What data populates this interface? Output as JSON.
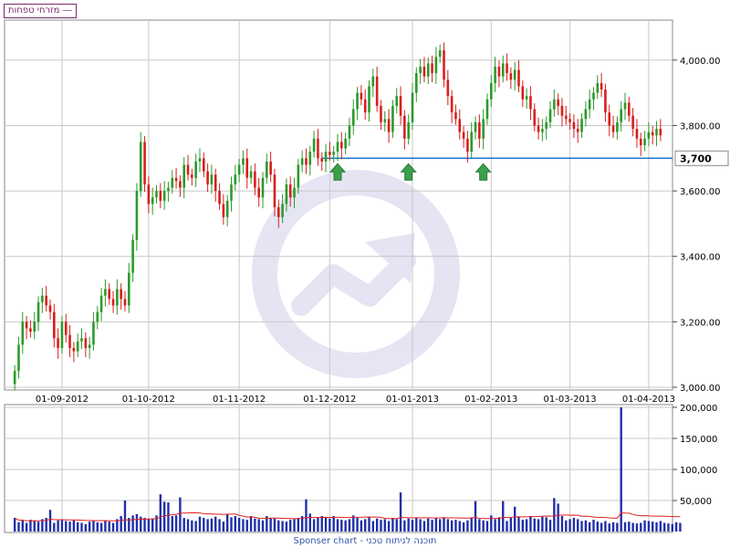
{
  "legend": {
    "label": "מזרחי טפחות ―"
  },
  "footer": {
    "text": "Sponser chart - תוכנה לניתוח טכני"
  },
  "colors": {
    "up": "#2a9a2a",
    "down": "#d81e1e",
    "volume": "#1f2fa8",
    "volume_ma": "#e02020",
    "support": "#1f78c8",
    "arrow": "#3aa04a",
    "grid": "#c8c8c8"
  },
  "chart_data": [
    {
      "type": "candlestick",
      "ylim": [
        3000,
        4100
      ],
      "y_ticks": [
        3000,
        3200,
        3400,
        3600,
        3800,
        4000
      ],
      "y_tick_labels": [
        "3,000.00",
        "3,200.00",
        "3,400.00",
        "3,600.00",
        "3,800.00",
        "4,000.00"
      ],
      "x_tick_labels": [
        "01-09-2012",
        "01-10-2012",
        "01-11-2012",
        "01-12-2012",
        "01-01-2013",
        "01-02-2013",
        "01-03-2013",
        "01-04-2013"
      ],
      "x_tick_bars": [
        12,
        34,
        57,
        80,
        101,
        121,
        141,
        161
      ],
      "support_level": {
        "value": 3700,
        "label": "3,700"
      },
      "arrow_bars": [
        82,
        100,
        119
      ],
      "close": [
        3050,
        3130,
        3200,
        3180,
        3170,
        3200,
        3260,
        3280,
        3250,
        3230,
        3150,
        3120,
        3200,
        3160,
        3120,
        3110,
        3140,
        3150,
        3120,
        3130,
        3200,
        3230,
        3280,
        3300,
        3270,
        3250,
        3300,
        3270,
        3250,
        3350,
        3450,
        3600,
        3750,
        3620,
        3560,
        3580,
        3600,
        3570,
        3600,
        3610,
        3640,
        3630,
        3610,
        3680,
        3650,
        3640,
        3690,
        3700,
        3660,
        3620,
        3650,
        3600,
        3560,
        3520,
        3570,
        3620,
        3650,
        3680,
        3700,
        3640,
        3660,
        3610,
        3580,
        3640,
        3690,
        3650,
        3550,
        3520,
        3560,
        3620,
        3580,
        3610,
        3680,
        3700,
        3680,
        3720,
        3760,
        3700,
        3690,
        3720,
        3710,
        3720,
        3750,
        3730,
        3760,
        3800,
        3850,
        3900,
        3880,
        3840,
        3920,
        3950,
        3860,
        3810,
        3820,
        3780,
        3860,
        3890,
        3830,
        3760,
        3810,
        3900,
        3960,
        3980,
        3950,
        3990,
        3960,
        4010,
        4030,
        3940,
        3890,
        3840,
        3820,
        3780,
        3760,
        3720,
        3780,
        3810,
        3760,
        3820,
        3880,
        3930,
        3980,
        3950,
        3990,
        3960,
        3940,
        3970,
        3920,
        3880,
        3890,
        3850,
        3800,
        3780,
        3790,
        3810,
        3850,
        3880,
        3860,
        3830,
        3820,
        3810,
        3790,
        3780,
        3820,
        3850,
        3880,
        3900,
        3930,
        3910,
        3840,
        3800,
        3780,
        3810,
        3850,
        3870,
        3830,
        3790,
        3760,
        3740,
        3760,
        3780,
        3770,
        3790,
        3770
      ],
      "volume": [
        22000,
        15000,
        18000,
        14000,
        19000,
        17000,
        16000,
        20000,
        22000,
        35000,
        14000,
        18000,
        19000,
        17000,
        16000,
        18000,
        15000,
        14000,
        12000,
        16000,
        17000,
        15000,
        14000,
        18000,
        16000,
        14000,
        20000,
        25000,
        50000,
        22000,
        26000,
        28000,
        24000,
        22000,
        20000,
        21000,
        26000,
        60000,
        48000,
        47000,
        25000,
        26000,
        55000,
        22000,
        20000,
        18000,
        17000,
        24000,
        22000,
        20000,
        21000,
        24000,
        20000,
        16000,
        28000,
        23000,
        25000,
        22000,
        20000,
        19000,
        25000,
        21000,
        20000,
        18000,
        25000,
        22000,
        21000,
        18000,
        17000,
        16000,
        19000,
        20000,
        22000,
        25000,
        52000,
        29000,
        20000,
        22000,
        25000,
        23000,
        21000,
        25000,
        20000,
        19000,
        18000,
        20000,
        26000,
        22000,
        18000,
        20000,
        23000,
        17000,
        21000,
        19000,
        20000,
        17000,
        22000,
        20000,
        63000,
        18000,
        21000,
        19000,
        22000,
        20000,
        17000,
        21000,
        19000,
        22000,
        20000,
        23000,
        20000,
        18000,
        19000,
        17000,
        15000,
        18000,
        23000,
        49000,
        20000,
        18000,
        17000,
        26000,
        20000,
        23000,
        49000,
        17000,
        22000,
        40000,
        23000,
        19000,
        20000,
        25000,
        21000,
        20000,
        24000,
        23000,
        19000,
        54000,
        45000,
        25000,
        18000,
        20000,
        22000,
        20000,
        17000,
        18000,
        15000,
        19000,
        16000,
        14000,
        17000,
        13000,
        15000,
        14000,
        12000,
        15000,
        16000,
        14000,
        13000,
        14000,
        18000,
        17000,
        16000,
        15000,
        17000,
        14000,
        13000,
        12000,
        15000,
        14000
      ],
      "volume_ylim": [
        0,
        200000
      ],
      "volume_ticks": [
        50000,
        100000,
        150000,
        200000
      ],
      "volume_tick_labels": [
        "50,000",
        "100,000",
        "150,000",
        "200,000"
      ],
      "volume_spike": {
        "bar": 154,
        "value": 200000
      }
    }
  ]
}
